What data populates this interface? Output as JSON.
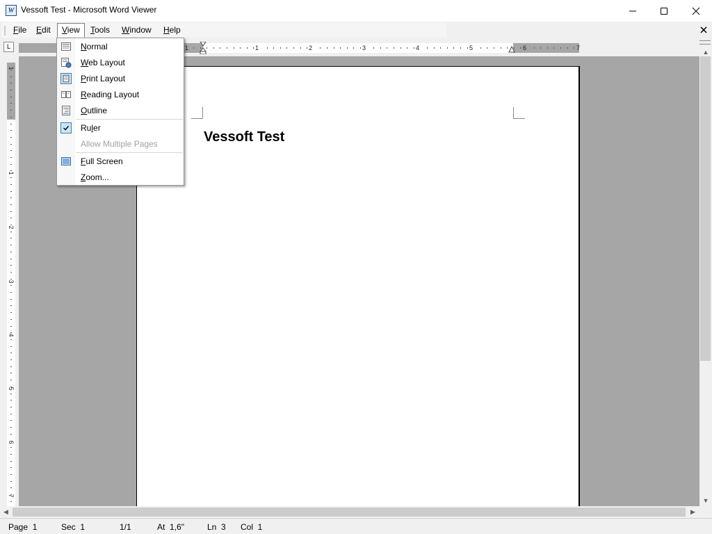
{
  "window": {
    "title": "Vessoft Test - Microsoft Word Viewer",
    "app_icon": "word-viewer-icon",
    "controls": {
      "minimize": "—",
      "maximize": "☐",
      "close": "✕"
    },
    "doc_close": "✕"
  },
  "menubar": {
    "items": [
      {
        "label": "File",
        "mnemonic": "F",
        "rest": "ile"
      },
      {
        "label": "Edit",
        "mnemonic": "E",
        "rest": "dit"
      },
      {
        "label": "View",
        "mnemonic": "V",
        "rest": "iew"
      },
      {
        "label": "Tools",
        "mnemonic": "T",
        "rest": "ools"
      },
      {
        "label": "Window",
        "mnemonic": "W",
        "rest": "indow"
      },
      {
        "label": "Help",
        "mnemonic": "H",
        "rest": "elp"
      }
    ],
    "open_menu": "View"
  },
  "view_menu": {
    "items": [
      {
        "pre": "",
        "mn": "N",
        "post": "ormal",
        "icon": "normal-view-icon",
        "enabled": true,
        "checked": false
      },
      {
        "pre": "",
        "mn": "W",
        "post": "eb Layout",
        "icon": "web-layout-icon",
        "enabled": true,
        "checked": false
      },
      {
        "pre": "",
        "mn": "P",
        "post": "rint Layout",
        "icon": "print-layout-icon",
        "enabled": true,
        "checked": true
      },
      {
        "pre": "",
        "mn": "R",
        "post": "eading Layout",
        "icon": "reading-layout-icon",
        "enabled": true,
        "checked": false
      },
      {
        "pre": "",
        "mn": "O",
        "post": "utline",
        "icon": "outline-view-icon",
        "enabled": true,
        "checked": false
      },
      {
        "pre": "Ru",
        "mn": "l",
        "post": "er",
        "icon": "checkmark-icon",
        "enabled": true,
        "checked": true
      },
      {
        "pre": "Allow Multiple Pages",
        "mn": "",
        "post": "",
        "icon": "",
        "enabled": false,
        "checked": false
      },
      {
        "pre": "",
        "mn": "F",
        "post": "ull Screen",
        "icon": "full-screen-icon",
        "enabled": true,
        "checked": false
      },
      {
        "pre": "",
        "mn": "Z",
        "post": "oom...",
        "icon": "",
        "enabled": true,
        "checked": false
      }
    ]
  },
  "ruler": {
    "horizontal_numbers": [
      "1",
      "1",
      "2",
      "3",
      "4",
      "5",
      "6",
      "7"
    ],
    "vertical_numbers": [
      "1",
      "1",
      "2",
      "3",
      "4",
      "5",
      "6",
      "7"
    ],
    "tab_selector": "L"
  },
  "document": {
    "heading": "Vessoft Test"
  },
  "statusbar": {
    "page": "Page  1",
    "sec": "Sec  1",
    "pages": "1/1",
    "at": "At  1,6\"",
    "ln": "Ln  3",
    "col": "Col  1"
  },
  "scroll": {
    "up": "▲",
    "down": "▼",
    "left": "◀",
    "right": "▶"
  }
}
